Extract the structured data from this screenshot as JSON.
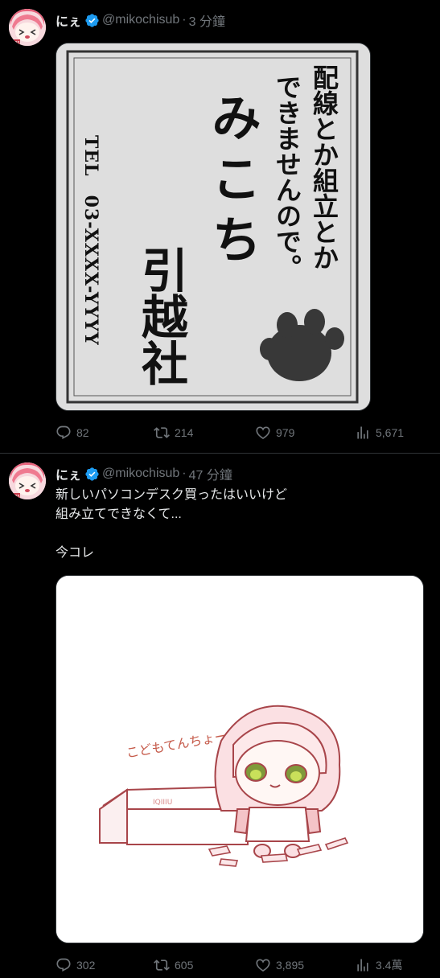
{
  "tweets": [
    {
      "display_name": "にぇ",
      "handle": "@mikochisub",
      "time": "3 分鐘",
      "sign": {
        "line1": "配線とか組立とか",
        "line2": "できませんので。",
        "name": "みこち",
        "company": "引越社",
        "tel": "TEL　03-XXXX-YYYY"
      },
      "stats": {
        "replies": "82",
        "retweets": "214",
        "likes": "979",
        "views": "5,671"
      }
    },
    {
      "display_name": "にぇ",
      "handle": "@mikochisub",
      "time": "47 分鐘",
      "text": "新しいパソコンデスク買ったはいいけど\n組み立てできなくて...\n\n今コレ",
      "illustration": {
        "caption": "こどもてんちょー",
        "box_label": "IQIIIU"
      },
      "stats": {
        "replies": "302",
        "retweets": "605",
        "likes": "3,895",
        "views": "3.4萬"
      }
    }
  ],
  "colors": {
    "background": "#000000",
    "text": "#e7e9ea",
    "muted": "#71767b",
    "verified": "#1d9bf0"
  }
}
